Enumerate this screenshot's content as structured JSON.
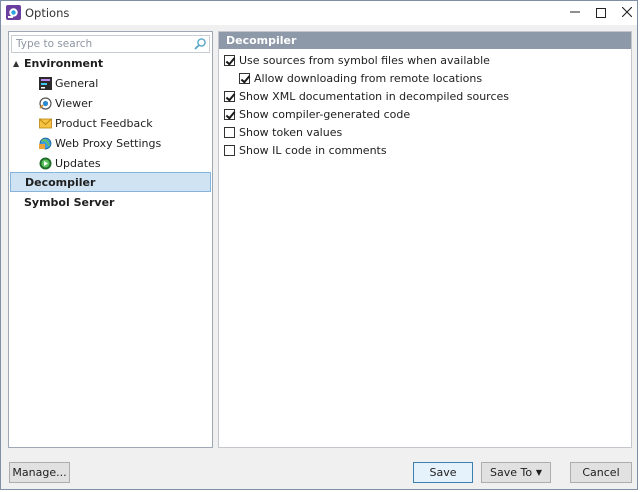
{
  "window": {
    "title": "Options"
  },
  "search": {
    "placeholder": "Type to search"
  },
  "tree": {
    "environment": "Environment",
    "children": [
      "General",
      "Viewer",
      "Product Feedback",
      "Web Proxy Settings",
      "Updates"
    ],
    "decompiler": "Decompiler",
    "symbol_server": "Symbol Server",
    "selected": "Decompiler"
  },
  "section": {
    "header": "Decompiler",
    "options": [
      {
        "label": "Use sources from symbol files when available",
        "checked": true
      },
      {
        "label": "Allow downloading from remote locations",
        "checked": true
      },
      {
        "label": "Show XML documentation in decompiled sources",
        "checked": true
      },
      {
        "label": "Show compiler-generated code",
        "checked": true
      },
      {
        "label": "Show token values",
        "checked": false
      },
      {
        "label": "Show IL code in comments",
        "checked": false
      }
    ]
  },
  "buttons": {
    "manage": "Manage...",
    "save": "Save",
    "save_to": "Save To",
    "cancel": "Cancel"
  },
  "icons": {
    "app": "dotpeek-app-icon",
    "search": "search-icon",
    "general": "general-icon",
    "viewer": "viewer-icon",
    "feedback": "envelope-icon",
    "proxy": "globe-icon",
    "updates": "updates-icon"
  },
  "colors": {
    "section_header_bg": "#8d99a8",
    "selection_bg": "#cfe3f3",
    "primary_button_border": "#3c7fb1"
  }
}
